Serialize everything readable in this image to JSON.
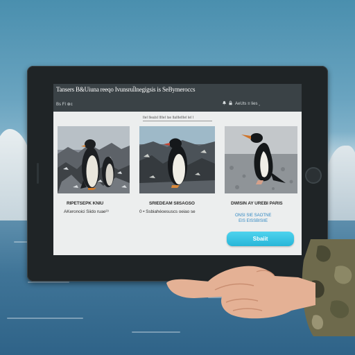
{
  "app": {
    "title": "Tansers B&Uiuna reeqo Ivunsrul̃lnegigsis is SeBymeroccs",
    "left_menu": "Bs  FI  ⊕c",
    "right_menu": "AeUts  ≡  Iies  ‸"
  },
  "content": {
    "section_caption": "IIeI IIeaIsI IIIIeI Ise IIaIIIeIIIeI IeI I",
    "cards": [
      {
        "label": "RIPETSEPK KNIU",
        "sub": "AKeronoici  Siido ruae²³"
      },
      {
        "label": "SRIEDEAM  SIISAGSO",
        "sub": "0 • Ssbiahéoesuscs oeiao se"
      },
      {
        "label": "DWISIN AY UREBI PARIS",
        "link": "ONSI SIE SAOTNE\nEIS EISSBISIIE"
      }
    ],
    "submit_label": "Sbaiit"
  },
  "colors": {
    "header_bg": "#3a4246",
    "screen_bg": "#eceeee",
    "button_accent": "#27b6d8",
    "link_blue": "#2e86c1",
    "tablet_bezel": "#1f2426"
  },
  "icons": {
    "header": [
      "bell-icon",
      "lock-icon"
    ],
    "hardware": [
      "home-button-icon"
    ]
  }
}
